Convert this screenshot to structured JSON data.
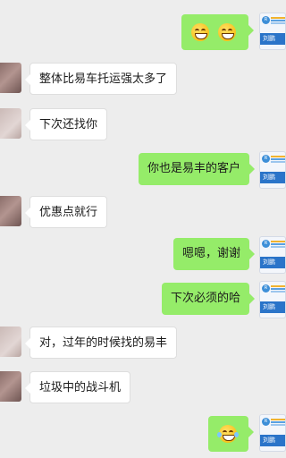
{
  "chat": {
    "contact_badge_text": "刘鹏",
    "messages": [
      {
        "side": "right",
        "type": "emoji",
        "emojis": [
          "grinning-face-icon",
          "grinning-face-icon"
        ]
      },
      {
        "side": "left",
        "type": "text",
        "text": "整体比易车托运强太多了"
      },
      {
        "side": "left",
        "type": "text",
        "text": "下次还找你"
      },
      {
        "side": "right",
        "type": "text",
        "text": "你也是易丰的客户"
      },
      {
        "side": "left",
        "type": "text",
        "text": "优惠点就行"
      },
      {
        "side": "right",
        "type": "text",
        "text": "嗯嗯，谢谢"
      },
      {
        "side": "right",
        "type": "text",
        "text": "下次必须的哈"
      },
      {
        "side": "left",
        "type": "text",
        "text": "对，过年的时候找的易丰"
      },
      {
        "side": "left",
        "type": "text",
        "text": "垃圾中的战斗机"
      },
      {
        "side": "right",
        "type": "emoji",
        "emojis": [
          "tears-of-joy-face-icon"
        ]
      }
    ]
  }
}
